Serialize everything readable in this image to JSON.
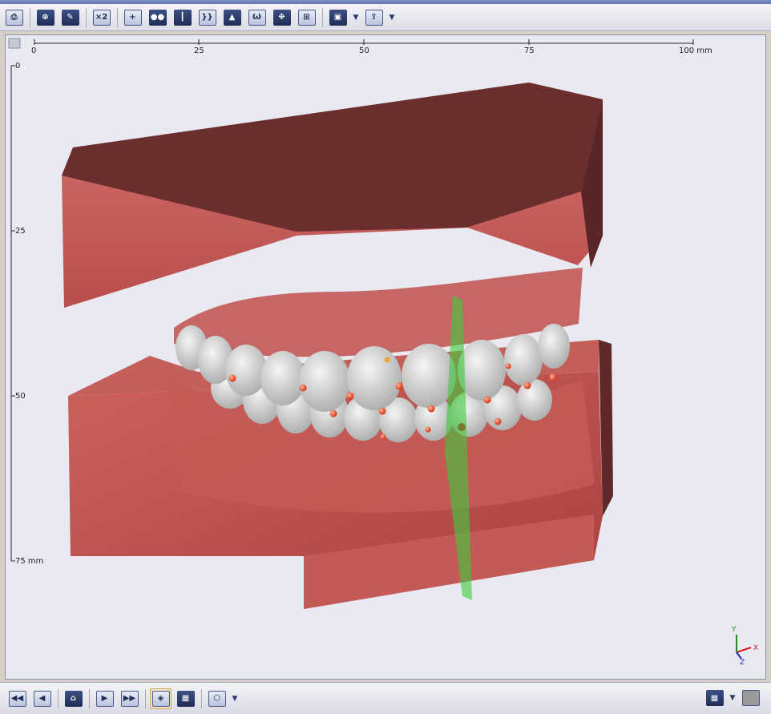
{
  "toolbar": {
    "buttons": [
      "print-icon",
      "add-patient-icon",
      "patient-edit-icon",
      "zoom-x2-icon",
      "add-point-icon",
      "patients-icon",
      "arch-split-icon",
      "brackets-icon",
      "gum-icon",
      "tooth-icon",
      "move-icon",
      "grid-frame-icon",
      "box-view-icon",
      "export-icon"
    ],
    "zoom_label": "×2"
  },
  "ruler": {
    "x_ticks": [
      "0",
      "25",
      "50",
      "75",
      "100 mm"
    ],
    "y_ticks": [
      "0",
      "25",
      "50",
      "75 mm"
    ]
  },
  "axes": {
    "y": "Y",
    "x": "X",
    "z": "Z"
  },
  "bottombar": {
    "buttons": [
      "skip-back-icon",
      "step-back-icon",
      "home-icon",
      "step-forward-icon",
      "skip-forward-icon",
      "view-mode-icon",
      "film-icon",
      "cube-view-icon"
    ]
  },
  "colors": {
    "gum": "#c9605c",
    "base_top": "#6b2e2f",
    "tooth": "#d8dad8",
    "marker": "#e8420e",
    "plane": "#3ecb3c"
  }
}
